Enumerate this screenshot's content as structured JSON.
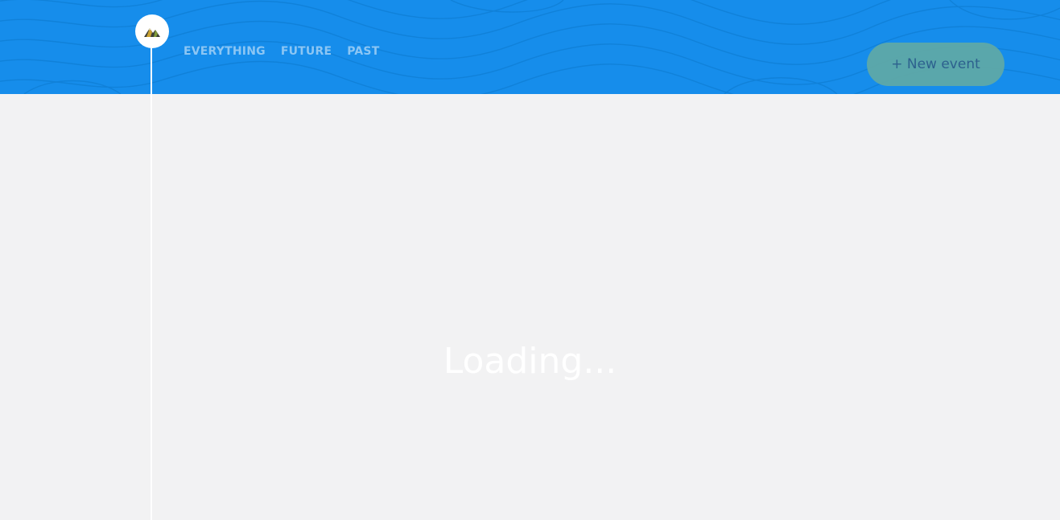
{
  "colors": {
    "header_background": "#168deb",
    "page_background": "#f2f2f3",
    "nav_text": "#8cc6f4",
    "button_background": "#5ea9a8",
    "button_text": "#2f5f8a",
    "loading_text": "#ffffff"
  },
  "header": {
    "logo_icon": "mountain-icon",
    "tabs": [
      {
        "label": "EVERYTHING"
      },
      {
        "label": "FUTURE"
      },
      {
        "label": "PAST"
      }
    ],
    "new_event_label": "+ New event"
  },
  "main": {
    "status_text": "Loading..."
  }
}
